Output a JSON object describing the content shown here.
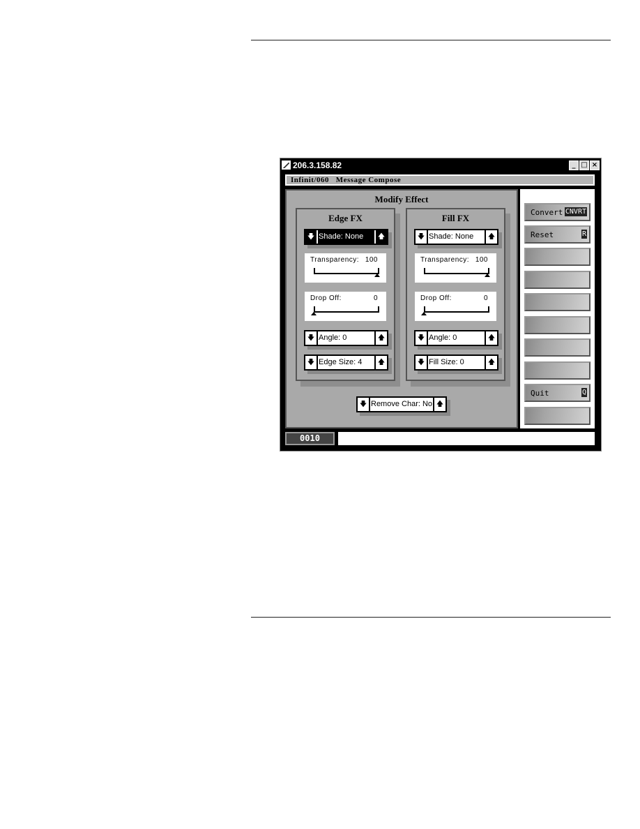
{
  "window": {
    "title": "206.3.158.82",
    "minimize": "_",
    "maximize": "□",
    "close": "×"
  },
  "subtitle": "Infinit/060   Message Compose",
  "panel": {
    "title": "Modify Effect",
    "edge": {
      "title": "Edge FX",
      "shade": "Shade: None",
      "transparency_label": "Transparency:",
      "transparency": "100",
      "transparency_level": 100,
      "dropoff_label": "Drop Off:",
      "dropoff": "0",
      "dropoff_level": 0,
      "angle": "Angle: 0",
      "size": "Edge Size: 4"
    },
    "fill": {
      "title": "Fill FX",
      "shade": "Shade: None",
      "transparency_label": "Transparency:",
      "transparency": "100",
      "transparency_level": 100,
      "dropoff_label": "Drop Off:",
      "dropoff": "0",
      "dropoff_level": 0,
      "angle": "Angle: 0",
      "size": "Fill Size: 0"
    },
    "remove_char": "Remove Char: No"
  },
  "arrows": {
    "down": "🡇",
    "up": "🡅"
  },
  "buttons": [
    {
      "label": "Convert",
      "key": "CNVRT"
    },
    {
      "label": "Reset",
      "key": "R"
    },
    {
      "label": "",
      "key": ""
    },
    {
      "label": "",
      "key": ""
    },
    {
      "label": "",
      "key": ""
    },
    {
      "label": "",
      "key": ""
    },
    {
      "label": "",
      "key": ""
    },
    {
      "label": "",
      "key": ""
    },
    {
      "label": "Quit",
      "key": "Q"
    },
    {
      "label": "",
      "key": ""
    }
  ],
  "status": {
    "counter": "0010",
    "message": ""
  }
}
